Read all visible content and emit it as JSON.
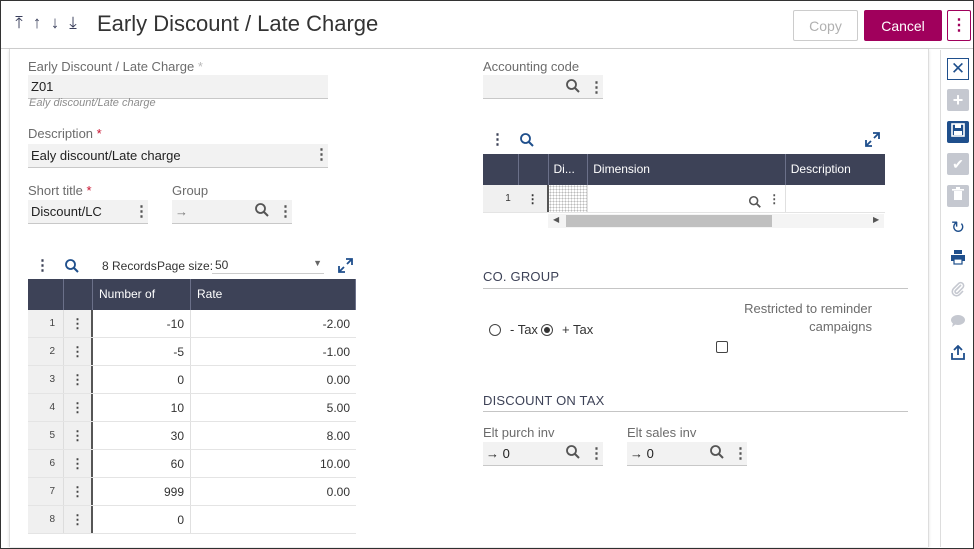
{
  "header": {
    "nav_arrows": [
      "⤒",
      "↑",
      "↓",
      "⤓"
    ],
    "title": "Early Discount / Late Charge",
    "copy_label": "Copy",
    "cancel_label": "Cancel",
    "more_label": "⋮"
  },
  "form": {
    "code_label": "Early Discount / Late Charge",
    "code_value": "Z01",
    "code_hint": "Ealy discount/Late charge",
    "description_label": "Description",
    "description_value": "Ealy discount/Late charge",
    "short_title_label": "Short title",
    "short_title_value": "Discount/LC",
    "group_label": "Group",
    "group_value": "→",
    "accounting_code_label": "Accounting code",
    "accounting_code_value": "",
    "required_mark": "*"
  },
  "grid_days": {
    "records_text": "8 Records",
    "page_size_label": "Page size:",
    "page_size_value": "50",
    "columns": [
      "Number of Days",
      "Rate"
    ],
    "rows": [
      {
        "num": "1",
        "days": "-10",
        "rate": "-2.00"
      },
      {
        "num": "2",
        "days": "-5",
        "rate": "-1.00"
      },
      {
        "num": "3",
        "days": "0",
        "rate": "0.00"
      },
      {
        "num": "4",
        "days": "10",
        "rate": "5.00"
      },
      {
        "num": "5",
        "days": "30",
        "rate": "8.00"
      },
      {
        "num": "6",
        "days": "60",
        "rate": "10.00"
      },
      {
        "num": "7",
        "days": "999",
        "rate": "0.00"
      },
      {
        "num": "8",
        "days": "0",
        "rate": ""
      }
    ]
  },
  "grid_dimensions": {
    "columns": [
      "Di...",
      "Dimension",
      "Description"
    ],
    "rows": [
      {
        "num": "1",
        "di": "",
        "dimension": "",
        "description": ""
      }
    ]
  },
  "co_group": {
    "title": "CO. GROUP",
    "option_minus": "- Tax",
    "option_plus": "+ Tax",
    "selected": "+ Tax",
    "restricted_label_1": "Restricted to reminder",
    "restricted_label_2": "campaigns",
    "restricted_checked": false
  },
  "discount_on_tax": {
    "title": "DISCOUNT ON TAX",
    "purch_label": "Elt purch inv",
    "purch_value": "→ 0",
    "sales_label": "Elt sales inv",
    "sales_value": "→ 0"
  },
  "toolbar": {
    "icons": [
      "close-icon",
      "add-icon",
      "save-icon",
      "check-icon",
      "delete-icon",
      "refresh-icon",
      "print-icon",
      "attachment-icon",
      "comment-icon",
      "share-icon"
    ]
  },
  "colors": {
    "accent": "#a0005c",
    "grid_header": "#3d4257",
    "toolbar_blue": "#1f4f8c"
  }
}
